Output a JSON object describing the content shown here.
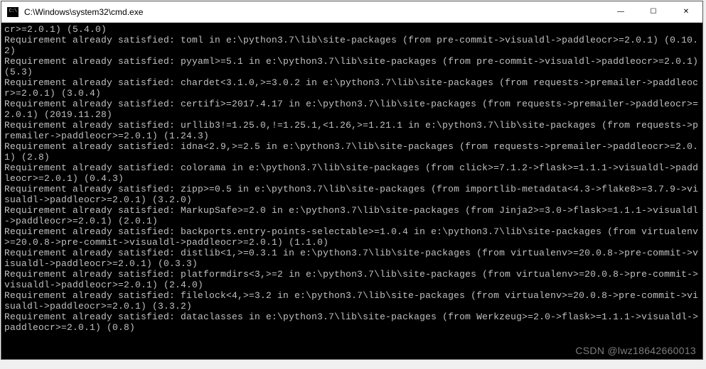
{
  "window": {
    "title": "C:\\Windows\\system32\\cmd.exe",
    "controls": {
      "minimize": "—",
      "maximize": "☐",
      "close": "✕"
    }
  },
  "terminal": {
    "lines": [
      "cr>=2.0.1) (5.4.0)",
      "Requirement already satisfied: toml in e:\\python3.7\\lib\\site-packages (from pre-commit->visualdl->paddleocr>=2.0.1) (0.10.2)",
      "Requirement already satisfied: pyyaml>=5.1 in e:\\python3.7\\lib\\site-packages (from pre-commit->visualdl->paddleocr>=2.0.1) (5.3)",
      "Requirement already satisfied: chardet<3.1.0,>=3.0.2 in e:\\python3.7\\lib\\site-packages (from requests->premailer->paddleocr>=2.0.1) (3.0.4)",
      "Requirement already satisfied: certifi>=2017.4.17 in e:\\python3.7\\lib\\site-packages (from requests->premailer->paddleocr>=2.0.1) (2019.11.28)",
      "Requirement already satisfied: urllib3!=1.25.0,!=1.25.1,<1.26,>=1.21.1 in e:\\python3.7\\lib\\site-packages (from requests->premailer->paddleocr>=2.0.1) (1.24.3)",
      "Requirement already satisfied: idna<2.9,>=2.5 in e:\\python3.7\\lib\\site-packages (from requests->premailer->paddleocr>=2.0.1) (2.8)",
      "Requirement already satisfied: colorama in e:\\python3.7\\lib\\site-packages (from click>=7.1.2->flask>=1.1.1->visualdl->paddleocr>=2.0.1) (0.4.3)",
      "Requirement already satisfied: zipp>=0.5 in e:\\python3.7\\lib\\site-packages (from importlib-metadata<4.3->flake8>=3.7.9->visualdl->paddleocr>=2.0.1) (3.2.0)",
      "Requirement already satisfied: MarkupSafe>=2.0 in e:\\python3.7\\lib\\site-packages (from Jinja2>=3.0->flask>=1.1.1->visualdl->paddleocr>=2.0.1) (2.0.1)",
      "Requirement already satisfied: backports.entry-points-selectable>=1.0.4 in e:\\python3.7\\lib\\site-packages (from virtualenv>=20.0.8->pre-commit->visualdl->paddleocr>=2.0.1) (1.1.0)",
      "Requirement already satisfied: distlib<1,>=0.3.1 in e:\\python3.7\\lib\\site-packages (from virtualenv>=20.0.8->pre-commit->visualdl->paddleocr>=2.0.1) (0.3.3)",
      "Requirement already satisfied: platformdirs<3,>=2 in e:\\python3.7\\lib\\site-packages (from virtualenv>=20.0.8->pre-commit->visualdl->paddleocr>=2.0.1) (2.4.0)",
      "Requirement already satisfied: filelock<4,>=3.2 in e:\\python3.7\\lib\\site-packages (from virtualenv>=20.0.8->pre-commit->visualdl->paddleocr>=2.0.1) (3.3.2)",
      "Requirement already satisfied: dataclasses in e:\\python3.7\\lib\\site-packages (from Werkzeug>=2.0->flask>=1.1.1->visualdl->paddleocr>=2.0.1) (0.8)"
    ]
  },
  "watermark": "CSDN @lwz18642660013"
}
